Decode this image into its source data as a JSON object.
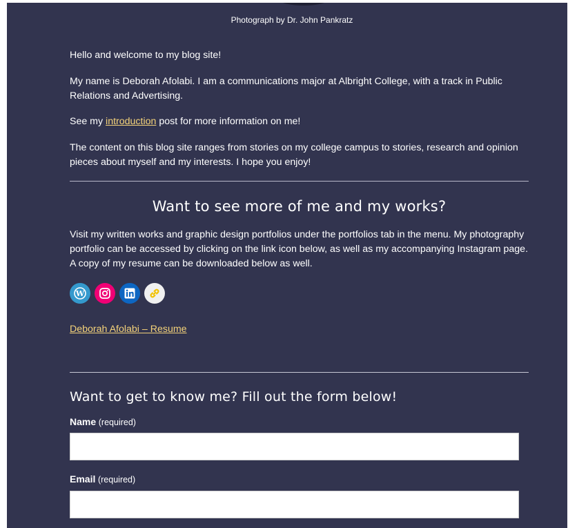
{
  "caption": "Photograph by Dr. John Pankratz",
  "intro": {
    "p1": "Hello and welcome to my blog site!",
    "p2": "My name is Deborah Afolabi. I am a communications major at Albright College, with a track in Public Relations and Advertising.",
    "p3_before": "See my ",
    "p3_link": "introduction",
    "p3_after": " post for more information on me!",
    "p4": "The content on this blog site ranges from stories on my college campus to stories, research and opinion pieces about myself and my interests. I hope you enjoy!"
  },
  "works": {
    "heading": "Want to see more of me and my works?",
    "text": "Visit my written works and graphic design portfolios under the portfolios tab in the menu. My photography portfolio can be accessed by clicking on the link icon below, as well as my accompanying Instagram page. A copy of my resume can be downloaded below as well.",
    "social_icons": [
      "wordpress-icon",
      "instagram-icon",
      "linkedin-icon",
      "link-icon"
    ],
    "resume_link": "Deborah Afolabi – Resume"
  },
  "form": {
    "heading": "Want to get to know me? Fill out the form below!",
    "name_label": "Name",
    "name_req": "(required)",
    "email_label": "Email",
    "email_req": "(required)"
  },
  "colors": {
    "background": "#32344f",
    "link": "#f5d37a"
  }
}
